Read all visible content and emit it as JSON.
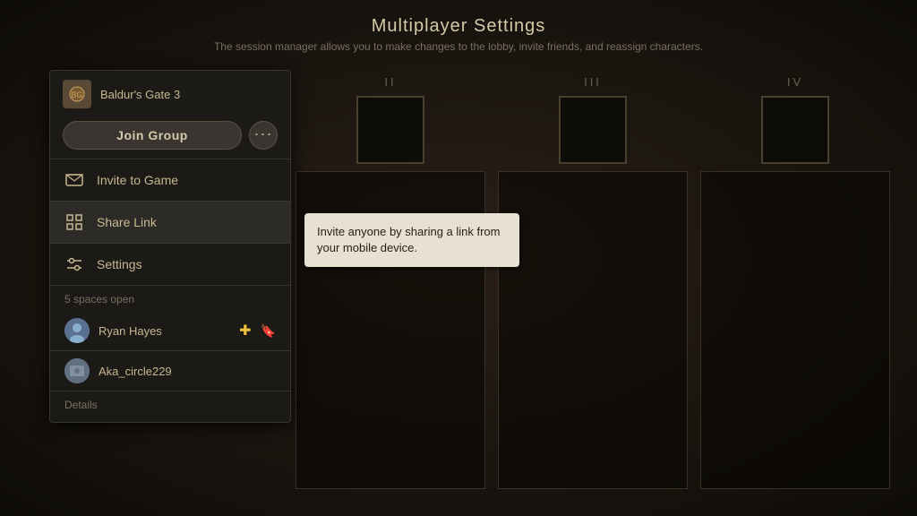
{
  "page": {
    "title": "Multiplayer Settings",
    "subtitle": "The session manager allows you to make changes to the lobby, invite friends, and reassign characters."
  },
  "slots": [
    {
      "label": "II"
    },
    {
      "label": "III"
    },
    {
      "label": "IV"
    }
  ],
  "dropdown": {
    "game_title": "Baldur's Gate 3",
    "join_btn_label": "Join Group",
    "more_btn_label": "···",
    "menu_items": [
      {
        "id": "invite",
        "label": "Invite to Game",
        "icon": "🎮"
      },
      {
        "id": "share",
        "label": "Share Link",
        "icon": "🔲"
      },
      {
        "id": "settings",
        "label": "Settings",
        "icon": "⇌"
      }
    ],
    "spaces_label": "5 spaces open",
    "players": [
      {
        "name": "Ryan Hayes",
        "has_ps": true,
        "has_bookmark": true
      },
      {
        "name": "Aka_circle229",
        "has_ps": false,
        "has_bookmark": false
      }
    ],
    "details_label": "Details"
  },
  "tooltip": {
    "text": "Invite anyone by sharing a link from your mobile device."
  }
}
